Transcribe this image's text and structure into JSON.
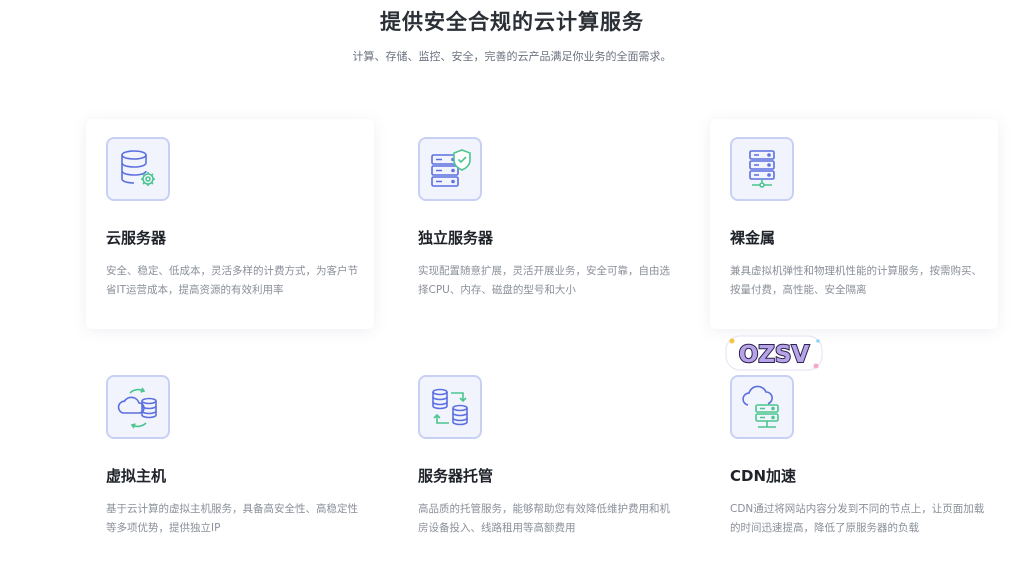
{
  "section": {
    "title": "提供安全合规的云计算服务",
    "subtitle": "计算、存储、监控、安全，完善的云产品满足你业务的全面需求。"
  },
  "cards": [
    {
      "icon": "cloud-server-gear-icon",
      "title": "云服务器",
      "description": "安全、稳定、低成本，灵活多样的计费方式，为客户节省IT运营成本，提高资源的有效利用率"
    },
    {
      "icon": "server-shield-icon",
      "title": "独立服务器",
      "description": "实现配置随意扩展，灵活开展业务，安全可靠，自由选择CPU、内存、磁盘的型号和大小"
    },
    {
      "icon": "bare-metal-server-icon",
      "title": "裸金属",
      "description": "兼具虚拟机弹性和物理机性能的计算服务，按需购买、按量付费，高性能、安全隔离"
    },
    {
      "icon": "cloud-database-sync-icon",
      "title": "虚拟主机",
      "description": "基于云计算的虚拟主机服务，具备高安全性、高稳定性等多项优势，提供独立IP"
    },
    {
      "icon": "server-transfer-icon",
      "title": "服务器托管",
      "description": "高品质的托管服务，能够帮助您有效降低维护费用和机房设备投入、线路租用等高额费用"
    },
    {
      "icon": "cdn-cloud-server-icon",
      "title": "CDN加速",
      "description": "CDN通过将网站内容分发到不同的节点上，让页面加载的时间迅速提高，降低了原服务器的负载"
    }
  ],
  "sticker": {
    "text": "OZSV"
  },
  "colors": {
    "icon_stroke": "#5b6fe0",
    "icon_border": "#c8d1f5",
    "icon_bg": "#f1f4fd",
    "accent_green": "#4cc58f"
  }
}
